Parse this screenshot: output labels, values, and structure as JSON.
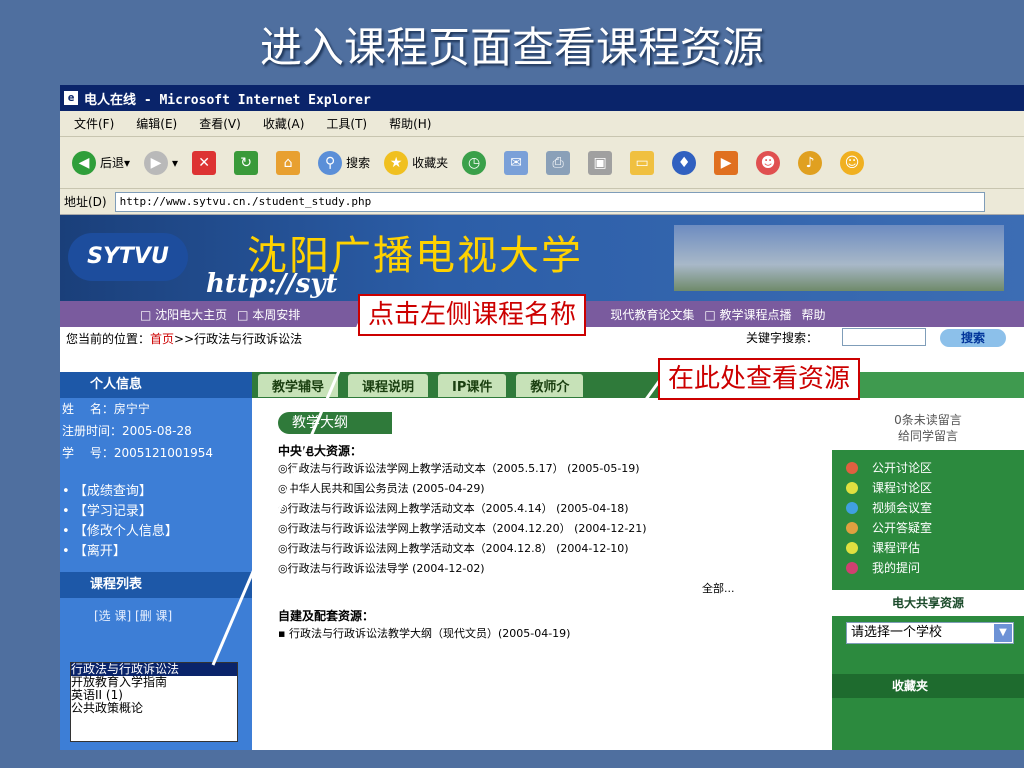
{
  "slide_title": "进入课程页面查看课程资源",
  "window_title": "电人在线 - Microsoft Internet Explorer",
  "menu": [
    "文件(F)",
    "编辑(E)",
    "查看(V)",
    "收藏(A)",
    "工具(T)",
    "帮助(H)"
  ],
  "toolbar": {
    "back": "后退",
    "search": "搜索",
    "favorites": "收藏夹"
  },
  "address": {
    "label": "地址(D)",
    "url": "http://www.sytvu.cn./student_study.php"
  },
  "banner": {
    "logo": "SYTVU",
    "name": "沈阳广播电视大学",
    "url": "http://syt"
  },
  "nav": [
    "□ 沈阳电大主页",
    "□ 本周安排",
    "现代教育论文集",
    "□ 教学课程点播",
    "帮助"
  ],
  "breadcrumb": {
    "prefix": "您当前的位置：",
    "home": "首页",
    "path": ">>行政法与行政诉讼法",
    "keyword_label": "关键字搜索：",
    "search_button": "搜索"
  },
  "left": {
    "personal_heading": "个人信息",
    "name": "姓　 名：房宁宁",
    "reg": "注册时间：2005-08-28",
    "id": "学　 号：2005121001954",
    "links": [
      "【成绩查询】",
      "【学习记录】",
      "【修改个人信息】",
      "【离开】"
    ],
    "courses_heading": "课程列表",
    "course_buttons": "[选 课]  [删 课]",
    "courses": [
      "行政法与行政诉讼法",
      "开放教育入学指南",
      "英语II (1)",
      "公共政策概论"
    ]
  },
  "tabs": [
    "教学辅导",
    "课程说明",
    "IP课件",
    "教师介"
  ],
  "center": {
    "heading": "教学大纲",
    "section1": "中央电大资源：",
    "items": [
      "◎行政法与行政诉讼法学网上教学活动文本（2005.5.17） (2005-05-19)",
      "◎中华人民共和国公务员法 (2005-04-29)",
      "◎行政法与行政诉讼法网上教学活动文本（2005.4.14） (2005-04-18)",
      "◎行政法与行政诉讼法学网上教学活动文本（2004.12.20） (2004-12-21)",
      "◎行政法与行政诉讼法网上教学活动文本（2004.12.8） (2004-12-10)",
      "◎行政法与行政诉讼法导学 (2004-12-02)"
    ],
    "all": "全部...",
    "section2": "自建及配套资源：",
    "item2": "▪ 行政法与行政诉讼法教学大纲（现代文员）(2005-04-19)"
  },
  "right": {
    "msg": [
      "0条未读留言",
      "给同学留言"
    ],
    "items": [
      "公开讨论区",
      "课程讨论区",
      "视频会议室",
      "公开答疑室",
      "课程评估",
      "我的提问"
    ],
    "share_heading": "电大共享资源",
    "select": "请选择一个学校",
    "favorites": "收藏夹"
  },
  "callouts": [
    "点击左侧课程名称",
    "在此处查看资源"
  ]
}
